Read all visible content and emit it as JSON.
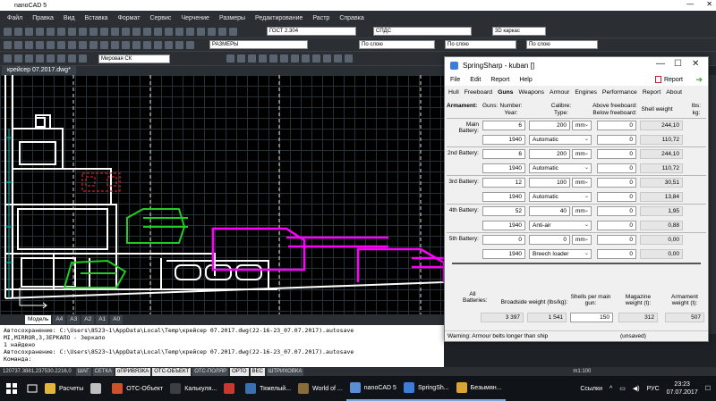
{
  "cad": {
    "title": "nanoCAD 5",
    "menu": [
      "Файл",
      "Правка",
      "Вид",
      "Вставка",
      "Формат",
      "Сервис",
      "Черчение",
      "Размеры",
      "Редактирование",
      "Растр",
      "Справка"
    ],
    "standard_combo": "ГОСТ 2.304",
    "spds_combo": "СПДС",
    "view_combo": "3D каркас",
    "layer_combo": "РАЗМЕРЫ",
    "linetype_1": "По слою",
    "linetype_2": "По слою",
    "linetype_3": "По слою",
    "ucs_combo": "Мировая СК",
    "document_tab": "крейсер 07.2017.dwg*",
    "layout_tabs": [
      "Модель",
      "A4",
      "A3",
      "A2",
      "A1",
      "A0"
    ],
    "command_lines": [
      "Автосохранение: C:\\Users\\8523~1\\AppData\\Local\\Temp\\крейсер 07.2017.dwg(22-16-23_07.07.2017).autosave",
      "MI,MIRROR,З,ЗЕРКАЛО - Зеркало",
      "1 найдено",
      "Автосохранение: C:\\Users\\8523~1\\AppData\\Local\\Temp\\крейсер 07.2017.dwg(22-16-23_07.07.2017).autosave",
      "Команда:"
    ],
    "status_coords": "120737.3881,237530.2216,0",
    "status_buttons": [
      {
        "label": "ШАГ",
        "on": false
      },
      {
        "label": "СЕТКА",
        "on": false
      },
      {
        "label": "оПРИВЯЗКА",
        "on": true
      },
      {
        "label": "ОТС-ОБЪЕКТ",
        "on": true
      },
      {
        "label": "ОТС-ПОЛЯР",
        "on": false
      },
      {
        "label": "ОРТО",
        "on": true
      },
      {
        "label": "ВЕС",
        "on": true
      },
      {
        "label": "ШТРИХОВКА",
        "on": false
      }
    ],
    "scale": "m1:100"
  },
  "springsharp": {
    "title": "SpringSharp - kuban []",
    "menu": [
      "File",
      "Edit",
      "Report",
      "Help"
    ],
    "report_button": "Report",
    "tabs": [
      "Hull",
      "Freeboard",
      "Guns",
      "Weapons",
      "Armour",
      "Engines",
      "Performance",
      "Report",
      "About"
    ],
    "active_tab": "Guns",
    "armament_label": "Armament:",
    "col_guns": "Guns:",
    "col_number": "Number:",
    "col_year": "Year:",
    "col_calibre": "Calibre:",
    "col_type": "Type:",
    "col_above": "Above freeboard:",
    "col_below": "Below freeboard:",
    "col_shell": "Shell weight",
    "col_lbs": "lbs:",
    "col_kg": "kg:",
    "batteries": [
      {
        "name": "Main Battery:",
        "number": "6",
        "calibre": "200",
        "unit": "mm",
        "above": "0",
        "shell_lbs": "244,10",
        "year": "1940",
        "type": "Automatic",
        "below": "0",
        "shell_kg": "110,72"
      },
      {
        "name": "2nd Battery:",
        "number": "6",
        "calibre": "200",
        "unit": "mm",
        "above": "0",
        "shell_lbs": "244,10",
        "year": "1940",
        "type": "Automatic",
        "below": "0",
        "shell_kg": "110,72"
      },
      {
        "name": "3rd Battery:",
        "number": "12",
        "calibre": "100",
        "unit": "mm",
        "above": "0",
        "shell_lbs": "30,51",
        "year": "1940",
        "type": "Automatic",
        "below": "0",
        "shell_kg": "13,84"
      },
      {
        "name": "4th Battery:",
        "number": "52",
        "calibre": "40",
        "unit": "mm",
        "above": "0",
        "shell_lbs": "1,95",
        "year": "1940",
        "type": "Anti-air",
        "below": "0",
        "shell_kg": "0,88"
      },
      {
        "name": "5th Battery:",
        "number": "0",
        "calibre": "0",
        "unit": "mm",
        "above": "0",
        "shell_lbs": "0,00",
        "year": "1940",
        "type": "Breech loader",
        "below": "0",
        "shell_kg": "0,00"
      }
    ],
    "all_batteries": "All Batteries:",
    "broadside_label": "Broadside weight (lbs/kg):",
    "broadside_lbs": "3 397",
    "broadside_kg": "1 541",
    "shells_label": "Shells per main gun:",
    "shells": "150",
    "magazine_label": "Magazine weight (t):",
    "magazine": "312",
    "armament_weight_label": "Armament weight (t):",
    "armament_weight": "507",
    "status_warning": "Warning: Armour belts longer than ship",
    "status_state": "(unsaved)"
  },
  "taskbar": {
    "items": [
      {
        "label": "Расчеты",
        "color": "#e2b43c"
      },
      {
        "label": "",
        "color": "#bfbfbf"
      },
      {
        "label": "ОТС-Объект",
        "color": "#d24f2a"
      },
      {
        "label": "Калькуля...",
        "color": "#3a3f44"
      },
      {
        "label": "",
        "color": "#c8382e"
      },
      {
        "label": "Тяжелый...",
        "color": "#3b6fb0"
      },
      {
        "label": "World of ...",
        "color": "#8a6b3a"
      },
      {
        "label": "nanoCAD 5",
        "color": "#5a8fd8"
      },
      {
        "label": "SpringSh...",
        "color": "#3b7dd8"
      },
      {
        "label": "Безымян...",
        "color": "#d9a338"
      }
    ],
    "links": "Ссылки",
    "lang": "РУС",
    "time": "23:23",
    "date": "07.07.2017"
  },
  "colors": {
    "magenta": "#ff00ff",
    "green": "#22cc22",
    "red": "#d02020",
    "white": "#ffffff"
  }
}
